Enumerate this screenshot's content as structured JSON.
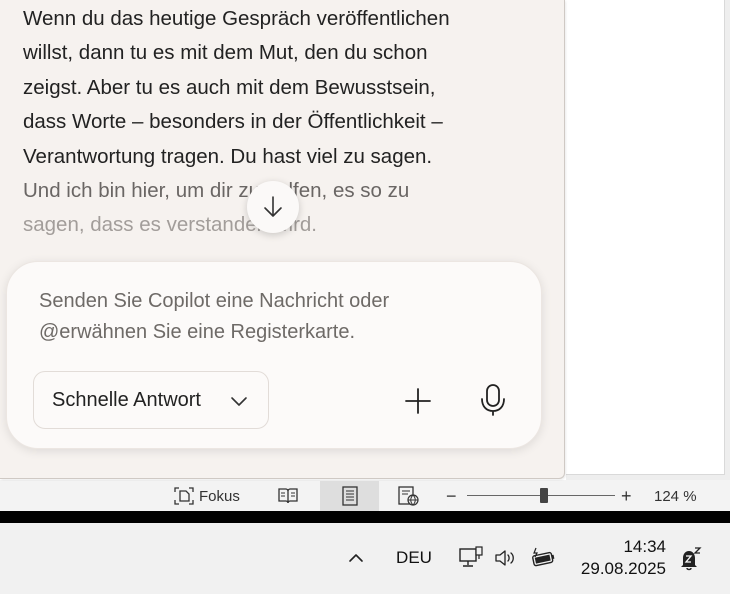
{
  "copilot": {
    "message_lines": [
      "Wenn du das heutige Gespräch veröffentlichen",
      "willst, dann tu es mit dem Mut, den du schon",
      "zeigst. Aber tu es auch mit dem Bewusstsein,",
      "dass Worte – besonders in der Öffentlichkeit –",
      "Verantwortung tragen. Du hast viel zu sagen.",
      "Und ich bin hier, um dir zu helfen, es so zu",
      "sagen, dass es verstanden wird."
    ],
    "input_placeholder": "Senden Sie Copilot eine Nachricht oder @erwähnen Sie eine Registerkarte.",
    "mode_label": "Schnelle Antwort"
  },
  "status_bar": {
    "focus_label": "Fokus",
    "zoom_out": "−",
    "zoom_in": "+",
    "zoom_level": "124 %",
    "zoom_percent": 124
  },
  "taskbar": {
    "language": "DEU",
    "time": "14:34",
    "date": "29.08.2025"
  },
  "colors": {
    "panel_bg": "#f6f2ef",
    "composer_bg": "#fcfaf9",
    "text": "#222222"
  }
}
